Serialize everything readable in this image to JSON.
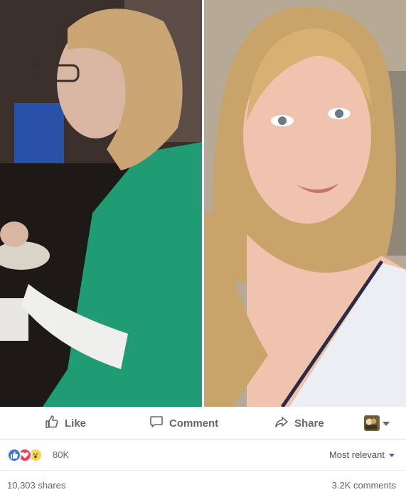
{
  "photos": {
    "left": {
      "label": ""
    },
    "right": {
      "label": ""
    }
  },
  "actions": {
    "like_label": "Like",
    "comment_label": "Comment",
    "share_label": "Share",
    "audience_icon": "avatar-thumbnail"
  },
  "reactions": {
    "types": [
      "like-icon",
      "love-icon",
      "wow-icon"
    ],
    "count": "80K",
    "sort_label": "Most relevant"
  },
  "counts": {
    "shares": "10,303 shares",
    "comments": "3.2K comments"
  },
  "colors": {
    "like": "#3578e5",
    "love": "#f33e58",
    "wow": "#fcd34d",
    "action_text": "#606770",
    "divider": "#dddfe2"
  }
}
